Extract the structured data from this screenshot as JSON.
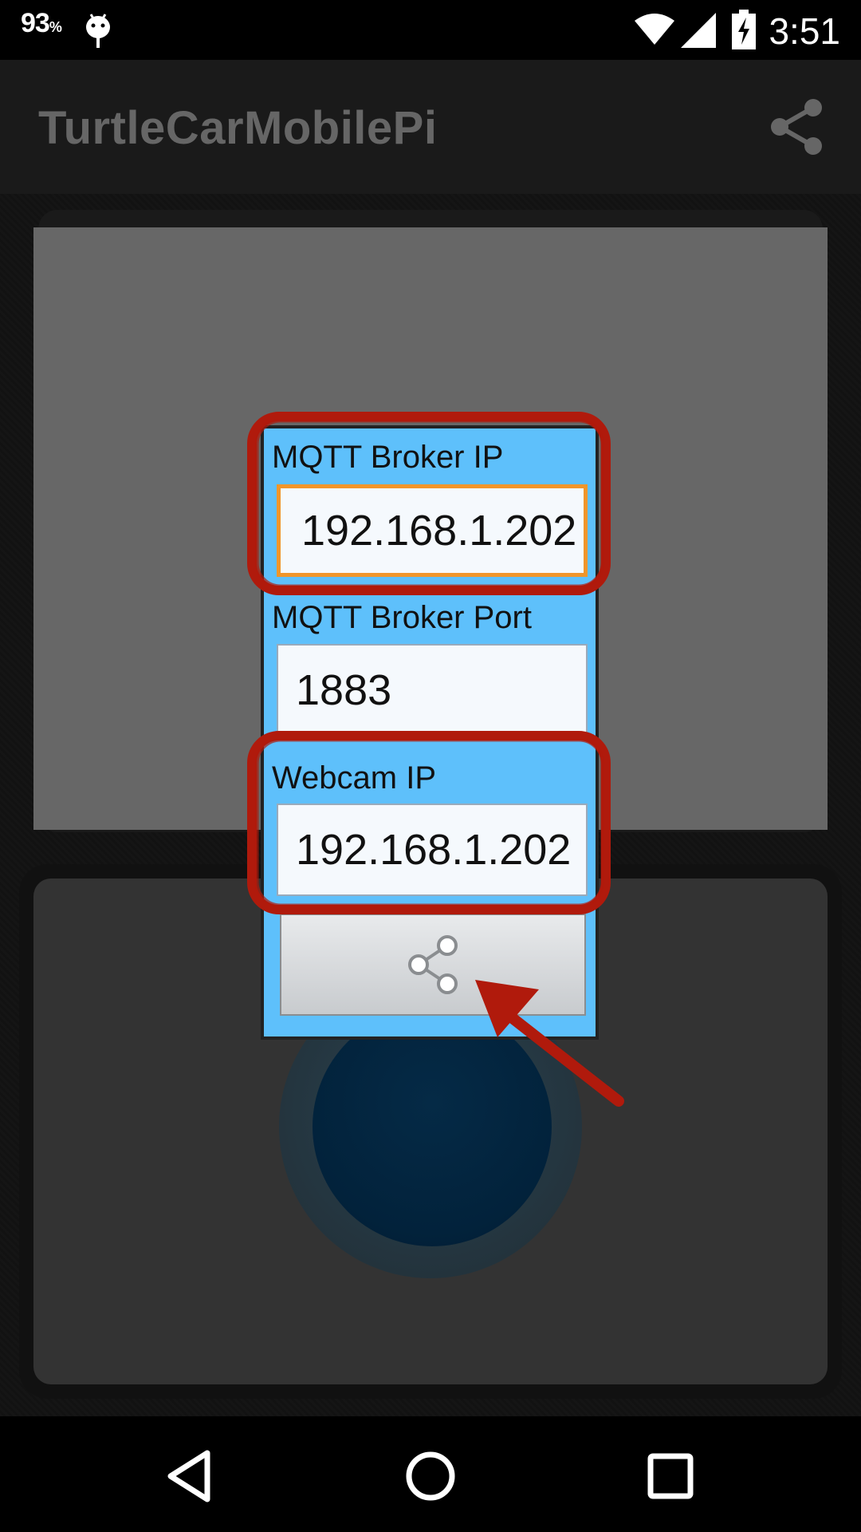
{
  "status_bar": {
    "battery_percent": "93",
    "battery_unit": "%",
    "time": "3:51",
    "icons": [
      "android-debug-icon",
      "wifi-icon",
      "signal-icon",
      "battery-charging-icon"
    ]
  },
  "action_bar": {
    "title": "TurtleCarMobilePi",
    "share_icon": "share-icon"
  },
  "dialog": {
    "broker_ip": {
      "label": "MQTT Broker IP",
      "value": "192.168.1.202"
    },
    "broker_port": {
      "label": "MQTT Broker Port",
      "value": "1883"
    },
    "webcam_ip": {
      "label": "Webcam IP",
      "value": "192.168.1.202"
    },
    "submit_icon": "share-icon"
  },
  "nav_bar": {
    "icons": [
      "back-icon",
      "home-icon",
      "recents-icon"
    ]
  },
  "colors": {
    "dialog_bg": "#5ec0fb",
    "focus_border": "#f0962a",
    "annotation": "#b01a0c"
  }
}
